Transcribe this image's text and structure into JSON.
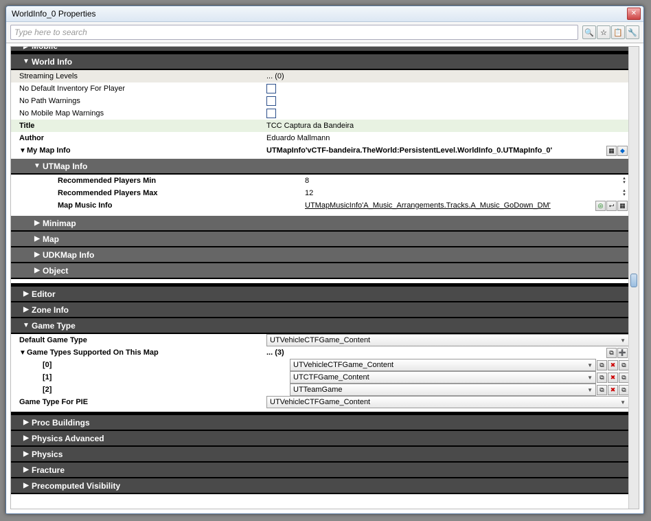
{
  "window": {
    "title": "WorldInfo_0 Properties"
  },
  "toolbar": {
    "search_placeholder": "Type here to search"
  },
  "sections": {
    "mobile": "Mobile",
    "worldInfo": {
      "header": "World Info",
      "rows": {
        "streaming": {
          "label": "Streaming Levels",
          "value": "... (0)"
        },
        "noInv": {
          "label": "No Default Inventory For Player"
        },
        "noPath": {
          "label": "No Path Warnings"
        },
        "noMobile": {
          "label": "No Mobile Map Warnings"
        },
        "title": {
          "label": "Title",
          "value": "TCC Captura da Bandeira"
        },
        "author": {
          "label": "Author",
          "value": "Eduardo Mallmann"
        },
        "myMap": {
          "label": "My Map Info",
          "value": "UTMapInfo'vCTF-bandeira.TheWorld:PersistentLevel.WorldInfo_0.UTMapInfo_0'"
        }
      },
      "utmap": {
        "header": "UTMap Info",
        "recMin": {
          "label": "Recommended Players Min",
          "value": "8"
        },
        "recMax": {
          "label": "Recommended Players Max",
          "value": "12"
        },
        "music": {
          "label": "Map Music Info",
          "value": "UTMapMusicInfo'A_Music_Arrangements.Tracks.A_Music_GoDown_DM'"
        }
      },
      "sub": {
        "minimap": "Minimap",
        "map": "Map",
        "udk": "UDKMap Info",
        "object": "Object"
      }
    },
    "editor": "Editor",
    "zone": "Zone Info",
    "gameType": {
      "header": "Game Type",
      "default": {
        "label": "Default Game Type",
        "value": "UTVehicleCTFGame_Content"
      },
      "supported": {
        "label": "Game Types Supported On This Map",
        "value": "... (3)"
      },
      "items": [
        {
          "idx": "[0]",
          "value": "UTVehicleCTFGame_Content"
        },
        {
          "idx": "[1]",
          "value": "UTCTFGame_Content"
        },
        {
          "idx": "[2]",
          "value": "UTTeamGame"
        }
      ],
      "pie": {
        "label": "Game Type For PIE",
        "value": "UTVehicleCTFGame_Content"
      }
    },
    "proc": "Proc Buildings",
    "physAdv": "Physics Advanced",
    "phys": "Physics",
    "frac": "Fracture",
    "precomp": "Precomputed Visibility"
  }
}
